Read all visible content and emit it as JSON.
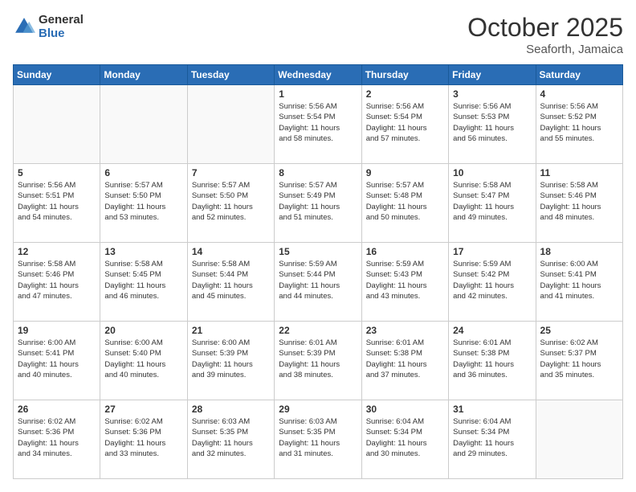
{
  "header": {
    "logo_line1": "General",
    "logo_line2": "Blue",
    "month": "October 2025",
    "location": "Seaforth, Jamaica"
  },
  "weekdays": [
    "Sunday",
    "Monday",
    "Tuesday",
    "Wednesday",
    "Thursday",
    "Friday",
    "Saturday"
  ],
  "weeks": [
    [
      {
        "day": "",
        "text": ""
      },
      {
        "day": "",
        "text": ""
      },
      {
        "day": "",
        "text": ""
      },
      {
        "day": "1",
        "text": "Sunrise: 5:56 AM\nSunset: 5:54 PM\nDaylight: 11 hours\nand 58 minutes."
      },
      {
        "day": "2",
        "text": "Sunrise: 5:56 AM\nSunset: 5:54 PM\nDaylight: 11 hours\nand 57 minutes."
      },
      {
        "day": "3",
        "text": "Sunrise: 5:56 AM\nSunset: 5:53 PM\nDaylight: 11 hours\nand 56 minutes."
      },
      {
        "day": "4",
        "text": "Sunrise: 5:56 AM\nSunset: 5:52 PM\nDaylight: 11 hours\nand 55 minutes."
      }
    ],
    [
      {
        "day": "5",
        "text": "Sunrise: 5:56 AM\nSunset: 5:51 PM\nDaylight: 11 hours\nand 54 minutes."
      },
      {
        "day": "6",
        "text": "Sunrise: 5:57 AM\nSunset: 5:50 PM\nDaylight: 11 hours\nand 53 minutes."
      },
      {
        "day": "7",
        "text": "Sunrise: 5:57 AM\nSunset: 5:50 PM\nDaylight: 11 hours\nand 52 minutes."
      },
      {
        "day": "8",
        "text": "Sunrise: 5:57 AM\nSunset: 5:49 PM\nDaylight: 11 hours\nand 51 minutes."
      },
      {
        "day": "9",
        "text": "Sunrise: 5:57 AM\nSunset: 5:48 PM\nDaylight: 11 hours\nand 50 minutes."
      },
      {
        "day": "10",
        "text": "Sunrise: 5:58 AM\nSunset: 5:47 PM\nDaylight: 11 hours\nand 49 minutes."
      },
      {
        "day": "11",
        "text": "Sunrise: 5:58 AM\nSunset: 5:46 PM\nDaylight: 11 hours\nand 48 minutes."
      }
    ],
    [
      {
        "day": "12",
        "text": "Sunrise: 5:58 AM\nSunset: 5:46 PM\nDaylight: 11 hours\nand 47 minutes."
      },
      {
        "day": "13",
        "text": "Sunrise: 5:58 AM\nSunset: 5:45 PM\nDaylight: 11 hours\nand 46 minutes."
      },
      {
        "day": "14",
        "text": "Sunrise: 5:58 AM\nSunset: 5:44 PM\nDaylight: 11 hours\nand 45 minutes."
      },
      {
        "day": "15",
        "text": "Sunrise: 5:59 AM\nSunset: 5:44 PM\nDaylight: 11 hours\nand 44 minutes."
      },
      {
        "day": "16",
        "text": "Sunrise: 5:59 AM\nSunset: 5:43 PM\nDaylight: 11 hours\nand 43 minutes."
      },
      {
        "day": "17",
        "text": "Sunrise: 5:59 AM\nSunset: 5:42 PM\nDaylight: 11 hours\nand 42 minutes."
      },
      {
        "day": "18",
        "text": "Sunrise: 6:00 AM\nSunset: 5:41 PM\nDaylight: 11 hours\nand 41 minutes."
      }
    ],
    [
      {
        "day": "19",
        "text": "Sunrise: 6:00 AM\nSunset: 5:41 PM\nDaylight: 11 hours\nand 40 minutes."
      },
      {
        "day": "20",
        "text": "Sunrise: 6:00 AM\nSunset: 5:40 PM\nDaylight: 11 hours\nand 40 minutes."
      },
      {
        "day": "21",
        "text": "Sunrise: 6:00 AM\nSunset: 5:39 PM\nDaylight: 11 hours\nand 39 minutes."
      },
      {
        "day": "22",
        "text": "Sunrise: 6:01 AM\nSunset: 5:39 PM\nDaylight: 11 hours\nand 38 minutes."
      },
      {
        "day": "23",
        "text": "Sunrise: 6:01 AM\nSunset: 5:38 PM\nDaylight: 11 hours\nand 37 minutes."
      },
      {
        "day": "24",
        "text": "Sunrise: 6:01 AM\nSunset: 5:38 PM\nDaylight: 11 hours\nand 36 minutes."
      },
      {
        "day": "25",
        "text": "Sunrise: 6:02 AM\nSunset: 5:37 PM\nDaylight: 11 hours\nand 35 minutes."
      }
    ],
    [
      {
        "day": "26",
        "text": "Sunrise: 6:02 AM\nSunset: 5:36 PM\nDaylight: 11 hours\nand 34 minutes."
      },
      {
        "day": "27",
        "text": "Sunrise: 6:02 AM\nSunset: 5:36 PM\nDaylight: 11 hours\nand 33 minutes."
      },
      {
        "day": "28",
        "text": "Sunrise: 6:03 AM\nSunset: 5:35 PM\nDaylight: 11 hours\nand 32 minutes."
      },
      {
        "day": "29",
        "text": "Sunrise: 6:03 AM\nSunset: 5:35 PM\nDaylight: 11 hours\nand 31 minutes."
      },
      {
        "day": "30",
        "text": "Sunrise: 6:04 AM\nSunset: 5:34 PM\nDaylight: 11 hours\nand 30 minutes."
      },
      {
        "day": "31",
        "text": "Sunrise: 6:04 AM\nSunset: 5:34 PM\nDaylight: 11 hours\nand 29 minutes."
      },
      {
        "day": "",
        "text": ""
      }
    ]
  ]
}
